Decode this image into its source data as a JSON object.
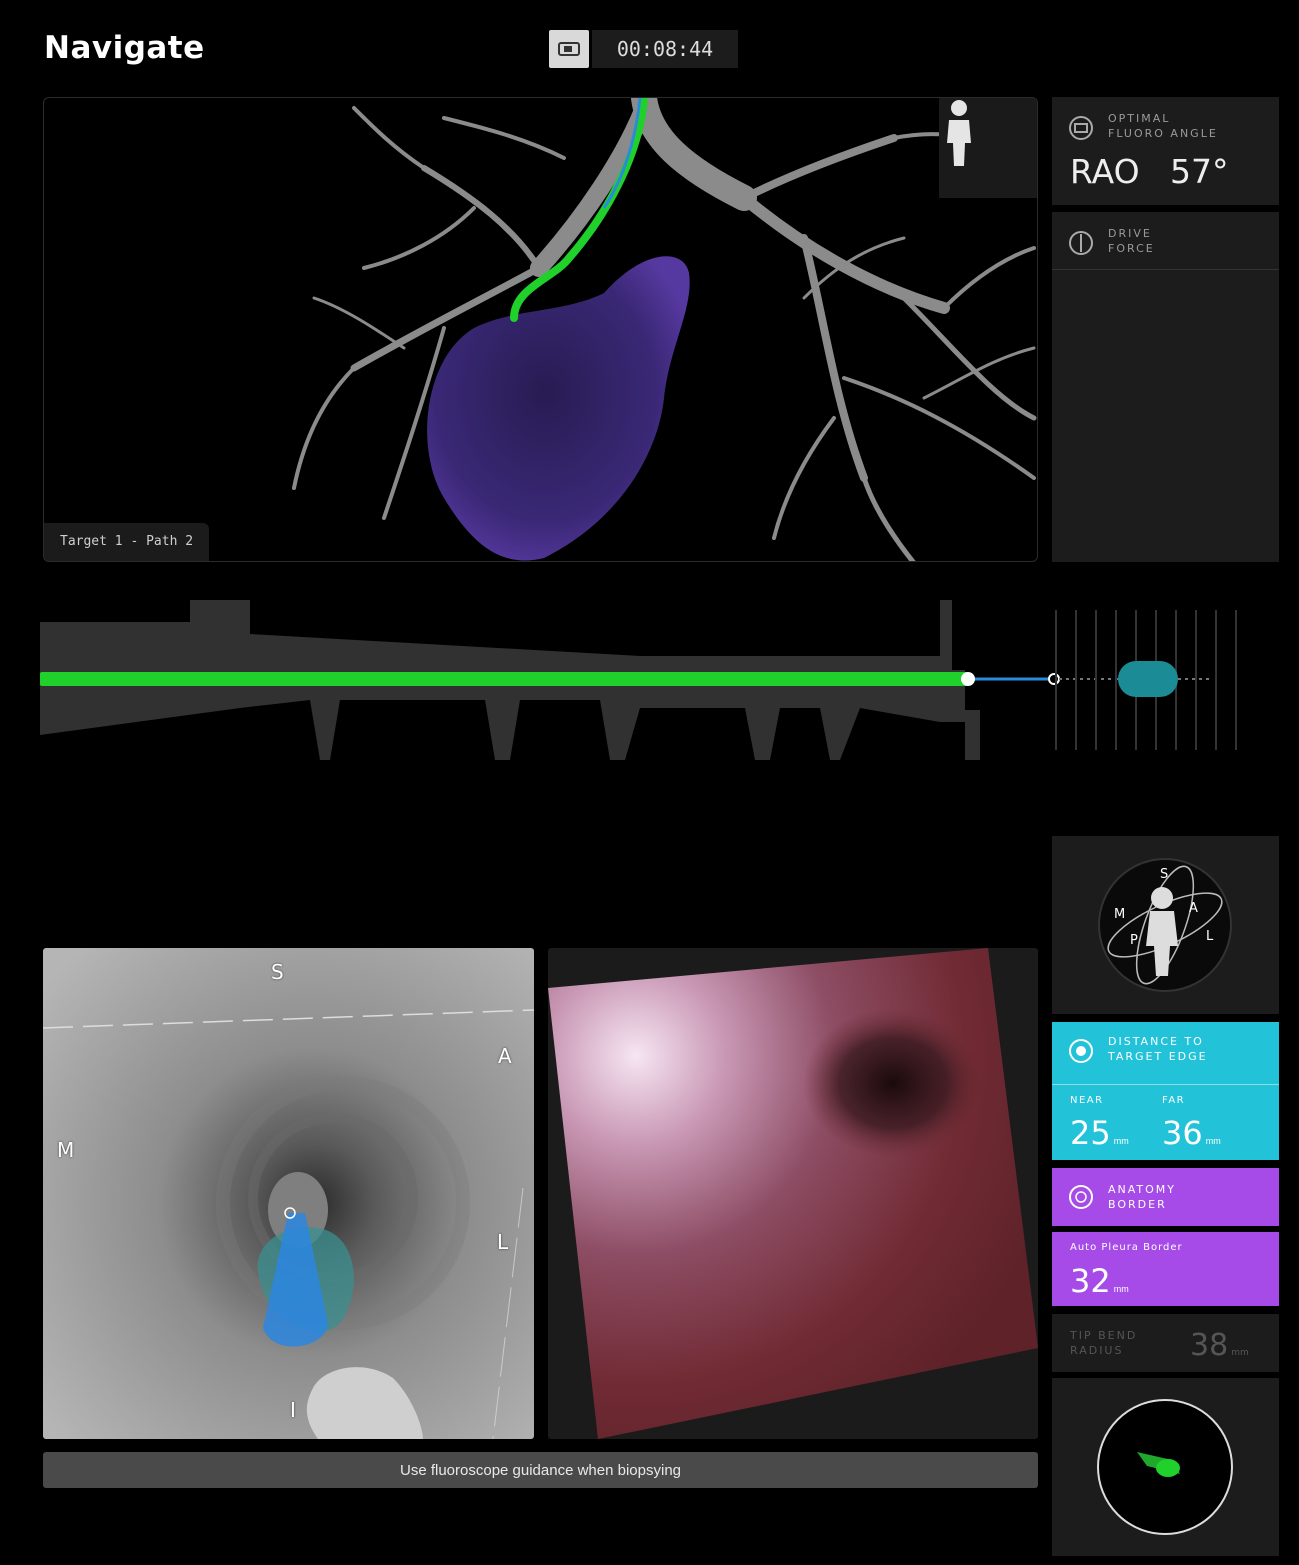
{
  "header": {
    "title": "Navigate",
    "timer": "00:08:44",
    "record_icon": "camera-icon"
  },
  "viewer3d": {
    "path_label": "Target 1 - Path 2",
    "orientation_icon": "person-icon",
    "colors": {
      "path": "#1fd12a",
      "target": "#5b3ca8",
      "airway": "#bdbdbd"
    }
  },
  "fluoro": {
    "title_line1": "OPTIMAL",
    "title_line2": "FLUORO ANGLE",
    "direction": "RAO",
    "angle": "57°"
  },
  "drive": {
    "title_line1": "DRIVE",
    "title_line2": "FORCE"
  },
  "orientation_globe": {
    "labels": [
      "S",
      "A",
      "M",
      "P",
      "L"
    ]
  },
  "distance": {
    "title_line1": "DISTANCE TO",
    "title_line2": "TARGET EDGE",
    "near_label": "NEAR",
    "near_value": "25",
    "far_label": "FAR",
    "far_value": "36",
    "unit": "mm",
    "color": "#22c3d9"
  },
  "anatomy": {
    "title_line1": "ANATOMY",
    "title_line2": "BORDER",
    "pleura_label": "Auto Pleura Border",
    "pleura_value": "32",
    "unit": "mm",
    "color": "#a64be8"
  },
  "tip": {
    "title_line1": "TIP BEND",
    "title_line2": "RADIUS",
    "value": "38",
    "unit": "mm"
  },
  "virtual_view": {
    "top": "S",
    "right_upper": "A",
    "left": "M",
    "right": "L",
    "bottom": "I"
  },
  "guidance": {
    "message": "Use fluoroscope guidance when biopsying"
  }
}
